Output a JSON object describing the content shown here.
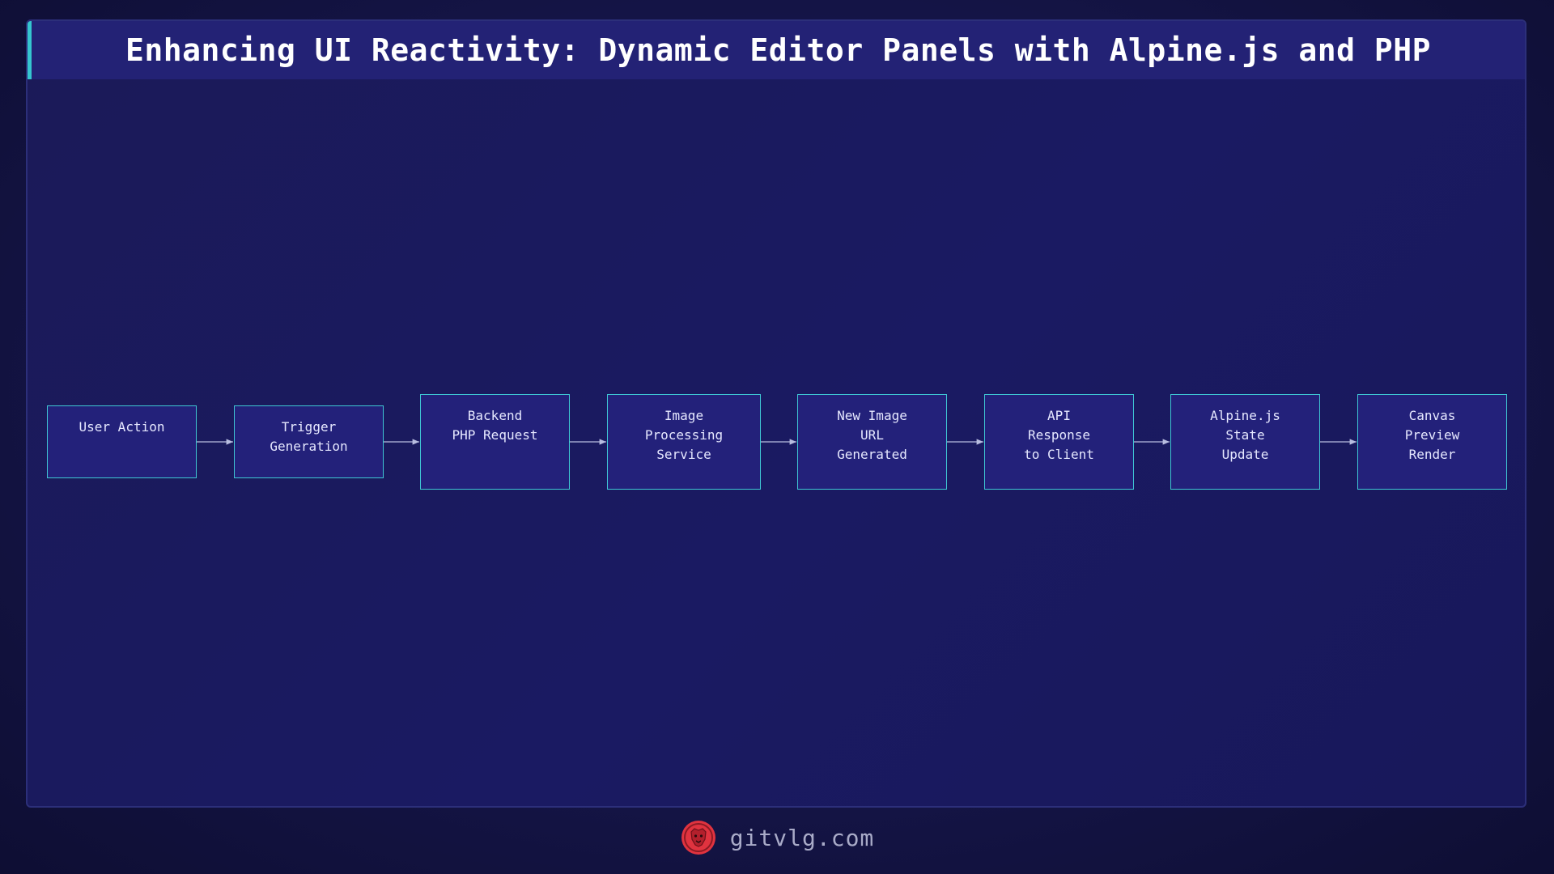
{
  "title": "Enhancing UI Reactivity: Dynamic Editor Panels with Alpine.js and PHP",
  "flow": {
    "nodes": [
      {
        "id": "user-action",
        "label": "User Action"
      },
      {
        "id": "trigger-generation",
        "label": "Trigger\nGeneration"
      },
      {
        "id": "backend-php-request",
        "label": "Backend\nPHP Request"
      },
      {
        "id": "image-processing-service",
        "label": "Image\nProcessing\nService"
      },
      {
        "id": "new-image-url-generated",
        "label": "New Image\nURL\nGenerated"
      },
      {
        "id": "api-response-to-client",
        "label": "API\nResponse\nto Client"
      },
      {
        "id": "alpinejs-state-update",
        "label": "Alpine.js\nState\nUpdate"
      },
      {
        "id": "canvas-preview-render",
        "label": "Canvas\nPreview\nRender"
      }
    ],
    "edges": [
      [
        "user-action",
        "trigger-generation"
      ],
      [
        "trigger-generation",
        "backend-php-request"
      ],
      [
        "backend-php-request",
        "image-processing-service"
      ],
      [
        "image-processing-service",
        "new-image-url-generated"
      ],
      [
        "new-image-url-generated",
        "api-response-to-client"
      ],
      [
        "api-response-to-client",
        "alpinejs-state-update"
      ],
      [
        "alpinejs-state-update",
        "canvas-preview-render"
      ]
    ]
  },
  "footer": {
    "site": "gitvlg.com",
    "logo_icon": "lion-head-icon"
  },
  "colors": {
    "background": "#141445",
    "title_bar": "#232275",
    "accent": "#35c6cf",
    "node_fill": "#23217a",
    "node_border": "#3fc7d4",
    "logo_red": "#e0333f"
  }
}
